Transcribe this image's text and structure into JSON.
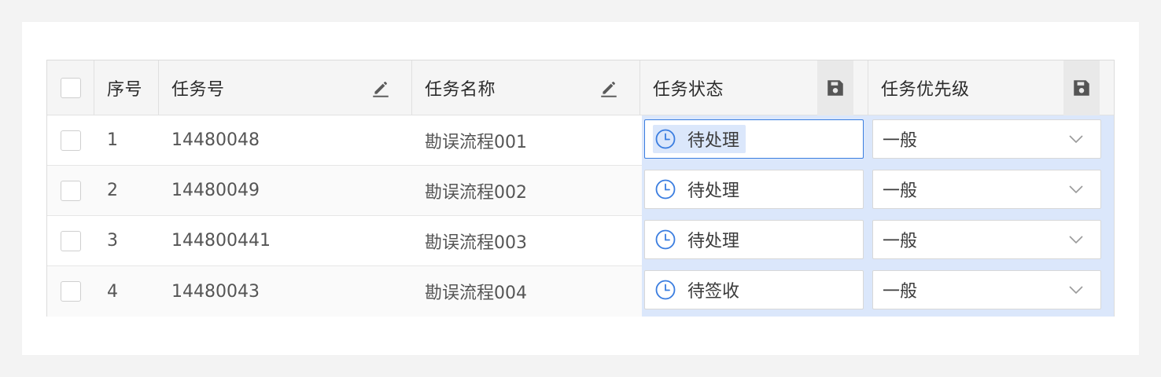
{
  "table": {
    "columns": {
      "index": "序号",
      "task_no": "任务号",
      "task_name": "任务名称",
      "task_status": "任务状态",
      "task_priority": "任务优先级"
    },
    "rows": [
      {
        "index": "1",
        "task_no": "14480048",
        "task_name": "勘误流程001",
        "status": "待处理",
        "priority": "一般"
      },
      {
        "index": "2",
        "task_no": "14480049",
        "task_name": "勘误流程002",
        "status": "待处理",
        "priority": "一般"
      },
      {
        "index": "3",
        "task_no": "144800441",
        "task_name": "勘误流程003",
        "status": "待处理",
        "priority": "一般"
      },
      {
        "index": "4",
        "task_no": "14480043",
        "task_name": "勘误流程004",
        "status": "待签收",
        "priority": "一般"
      }
    ],
    "icons": {
      "edit": "pencil-icon",
      "save": "save-icon",
      "status": "clock-icon",
      "dropdown": "chevron-down-icon"
    },
    "colors": {
      "accent": "#3a7de0",
      "edit_highlight": "#dbe7fb"
    }
  }
}
